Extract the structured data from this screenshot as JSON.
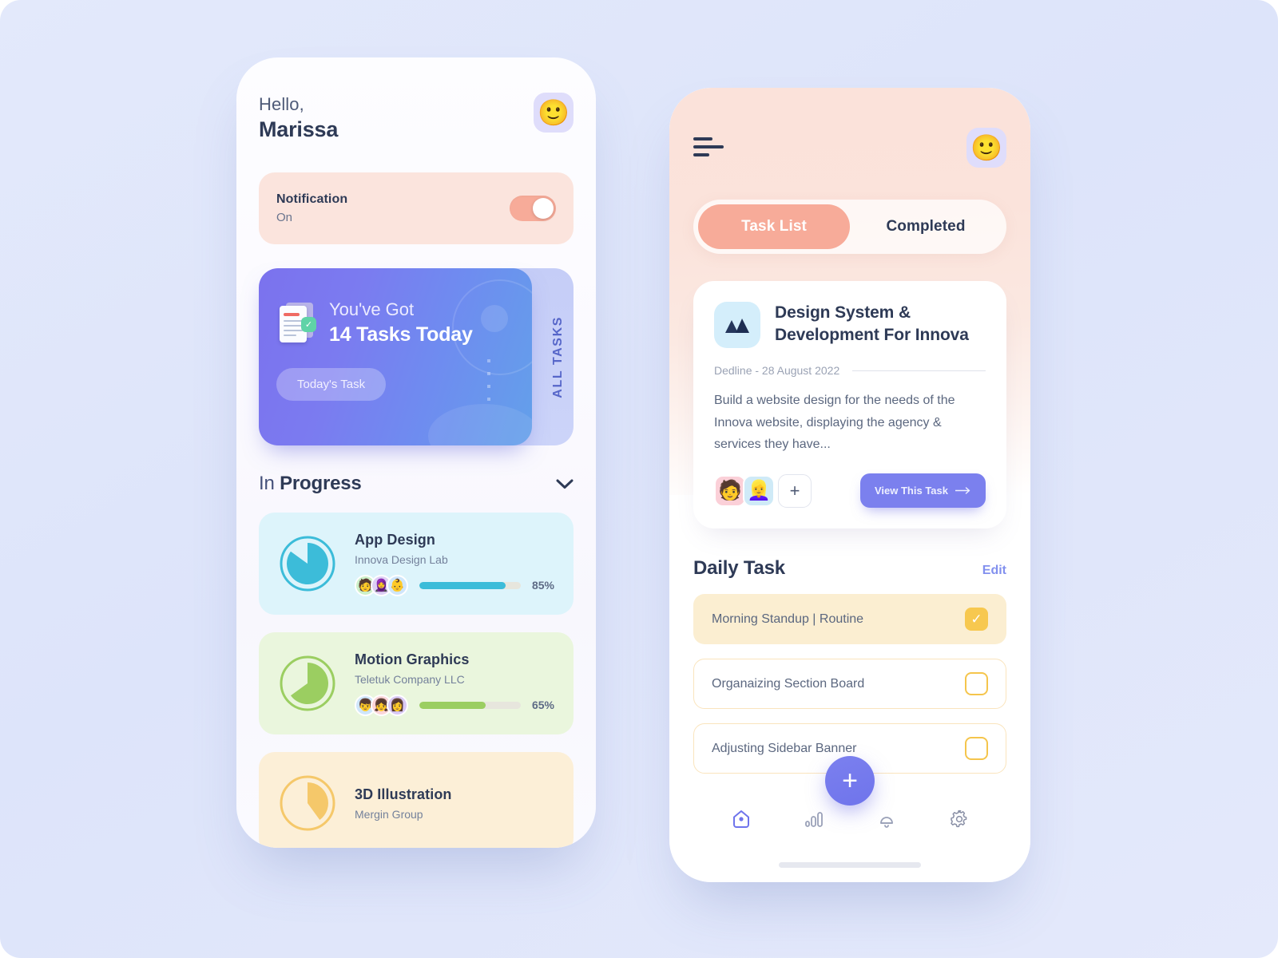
{
  "theme": {
    "bg": "#dfe6fa",
    "accent_purple": "#7b80ee",
    "accent_coral": "#f7ab99",
    "accent_yellow": "#f7c84f",
    "text_dark": "#2e3a56",
    "text_muted": "#74819b"
  },
  "left_screen": {
    "greeting": {
      "hello": "Hello,",
      "name": "Marissa"
    },
    "avatar_icon": "user-avatar-memoji",
    "notification": {
      "title": "Notification",
      "status": "On",
      "toggle_on": true
    },
    "hero": {
      "line1": "You've Got",
      "line2": "14 Tasks Today",
      "button": "Today's Task",
      "side_tab": "ALL TASKS",
      "doc_icon": "document-check-icon"
    },
    "section": {
      "title_light": "In ",
      "title_bold": "Progress",
      "chevron_icon": "chevron-down-icon"
    },
    "progress_items": [
      {
        "title": "App Design",
        "company": "Innova Design Lab",
        "percent": 85,
        "percent_label": "85%",
        "color": "#3cbcd9",
        "track": "#e7e6dd",
        "card_bg": "#ddf4fb",
        "avatars": [
          "🧑",
          "🧕",
          "👶"
        ],
        "avatar_bgs": [
          "#cdf0c8",
          "#ddd0f5",
          "#cfe6fb"
        ]
      },
      {
        "title": "Motion Graphics",
        "company": "Teletuk Company LLC",
        "percent": 65,
        "percent_label": "65%",
        "color": "#9bce61",
        "track": "#e7e6dd",
        "card_bg": "#eaf6dd",
        "avatars": [
          "👦",
          "👧",
          "👩"
        ],
        "avatar_bgs": [
          "#cfe6fb",
          "#fbd5d8",
          "#d9c9f5"
        ]
      },
      {
        "title": "3D Illustration",
        "company": "Mergin Group",
        "percent": 40,
        "percent_label": "",
        "color": "#f5c86a",
        "track": "#e7e6dd",
        "card_bg": "#fcefd7",
        "avatars": [],
        "avatar_bgs": []
      }
    ]
  },
  "right_screen": {
    "menu_icon": "hamburger-menu-icon",
    "avatar_icon": "user-avatar-memoji",
    "tabs": [
      {
        "label": "Task List",
        "active": true
      },
      {
        "label": "Completed",
        "active": false
      }
    ],
    "task_card": {
      "icon": "mountain-logo-icon",
      "title": "Design System & Development For Innova",
      "deadline": "Dedline - 28 August 2022",
      "description": "Build a website design for the needs of the Innova website, displaying the agency & services they have...",
      "members": [
        "🧑",
        "👱‍♀️"
      ],
      "member_bgs": [
        "#fbd0d8",
        "#cfeaf7"
      ],
      "add_member_label": "+",
      "view_button": "View This Task",
      "view_button_arrow": "arrow-right-icon"
    },
    "daily": {
      "title": "Daily Task",
      "edit_label": "Edit",
      "tasks": [
        {
          "label": "Morning Standup | Routine",
          "done": true
        },
        {
          "label": "Organaizing Section Board",
          "done": false
        },
        {
          "label": "Adjusting Sidebar Banner",
          "done": false
        }
      ]
    },
    "fab_label": "+",
    "nav": [
      {
        "icon": "home-icon",
        "active": true
      },
      {
        "icon": "bar-chart-icon",
        "active": false
      },
      {
        "icon": "bell-icon",
        "active": false
      },
      {
        "icon": "gear-icon",
        "active": false
      }
    ]
  }
}
